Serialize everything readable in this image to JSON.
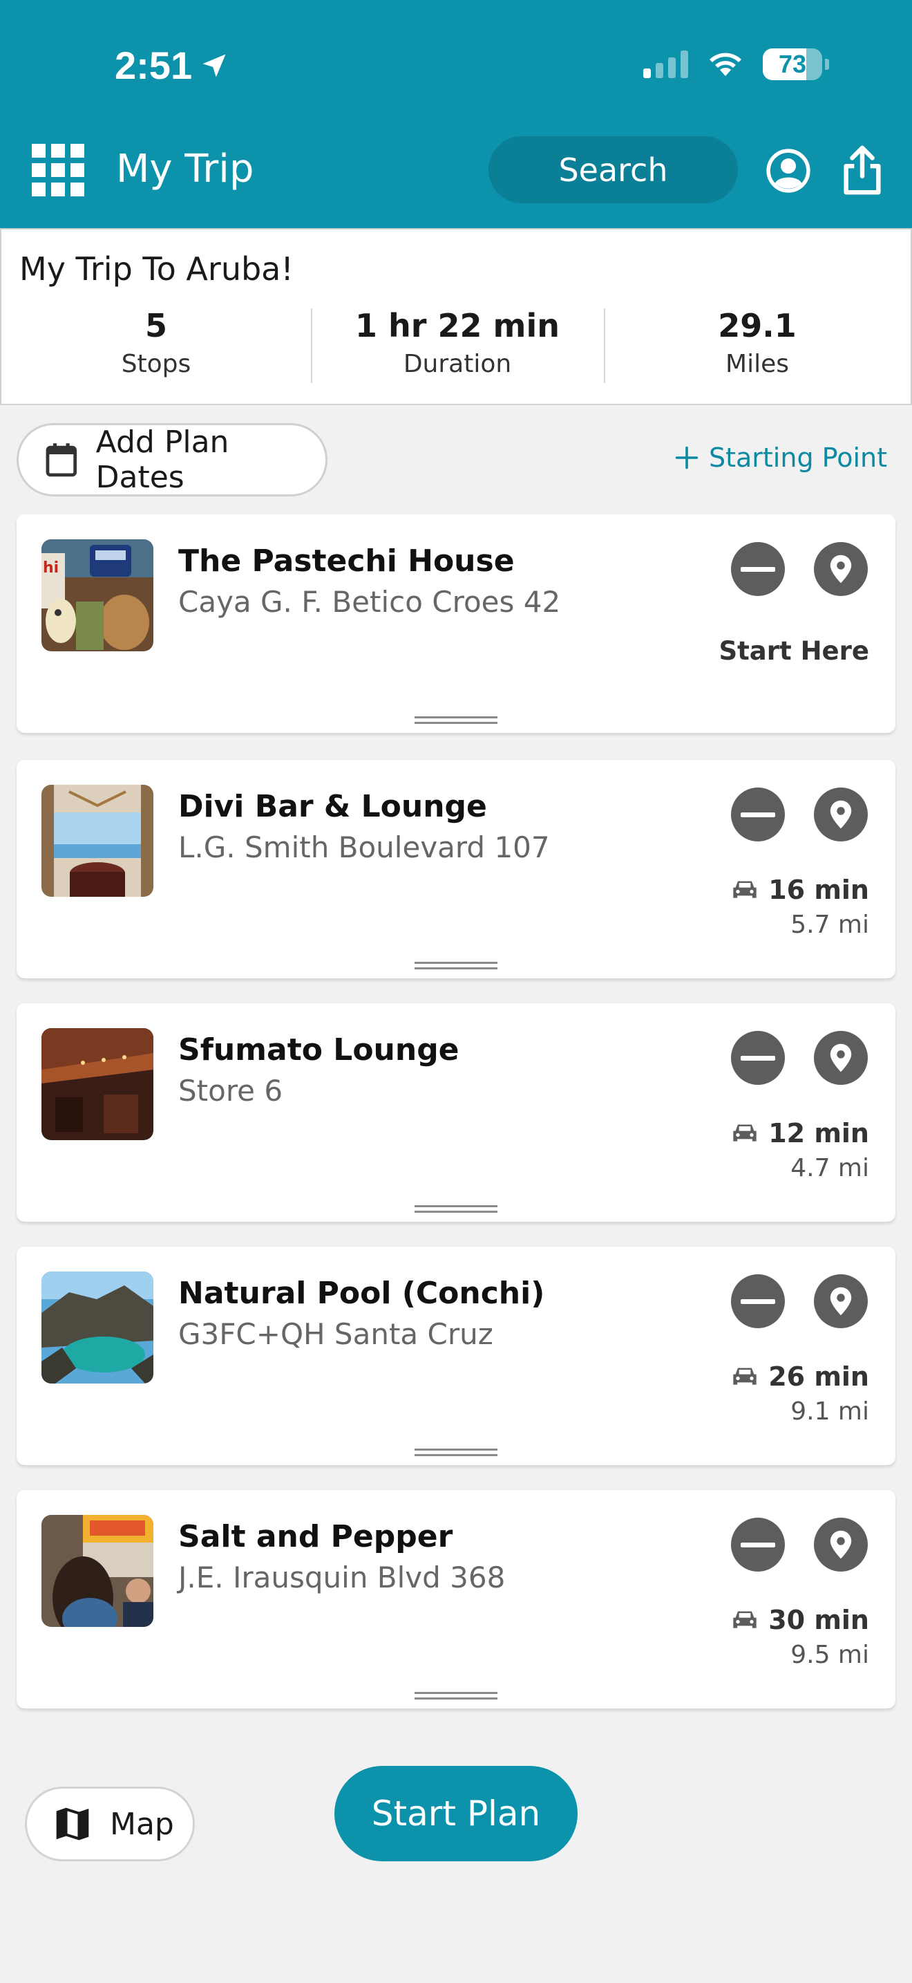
{
  "status_bar": {
    "time": "2:51",
    "battery": "73",
    "battery_level": 0.73
  },
  "app_bar": {
    "title": "My Trip",
    "search_label": "Search"
  },
  "summary": {
    "trip_name": "My Trip To Aruba!",
    "stats": [
      {
        "value": "5",
        "label": "Stops"
      },
      {
        "value": "1 hr 22 min",
        "label": "Duration"
      },
      {
        "value": "29.1",
        "label": "Miles"
      }
    ]
  },
  "actions": {
    "add_dates": "Add Plan Dates",
    "starting_point": "Starting Point"
  },
  "stops": [
    {
      "name": "The Pastechi House",
      "address": "Caya G. F. Betico Croes 42",
      "start_label": "Start Here",
      "drive_time": "",
      "distance": ""
    },
    {
      "name": "Divi Bar & Lounge",
      "address": "L.G. Smith Boulevard 107",
      "start_label": "",
      "drive_time": "16 min",
      "distance": "5.7 mi"
    },
    {
      "name": "Sfumato Lounge",
      "address": "Store 6",
      "start_label": "",
      "drive_time": "12 min",
      "distance": "4.7 mi"
    },
    {
      "name": "Natural Pool (Conchi)",
      "address": "G3FC+QH Santa Cruz",
      "start_label": "",
      "drive_time": "26 min",
      "distance": "9.1 mi"
    },
    {
      "name": "Salt and Pepper",
      "address": "J.E. Irausquin Blvd 368",
      "start_label": "",
      "drive_time": "30 min",
      "distance": "9.5 mi"
    }
  ],
  "bottom": {
    "map_label": "Map",
    "start_plan_label": "Start Plan"
  },
  "colors": {
    "brand": "#0c93ab",
    "brand_dark": "#0a7f95",
    "icon_gray": "#5d5d5d"
  },
  "icons": [
    "location-arrow-icon",
    "signal-icon",
    "wifi-icon",
    "battery-icon",
    "grid-menu-icon",
    "account-icon",
    "share-icon",
    "calendar-icon",
    "plus-icon",
    "remove-icon",
    "map-pin-icon",
    "car-icon",
    "drag-handle-icon",
    "map-icon"
  ]
}
